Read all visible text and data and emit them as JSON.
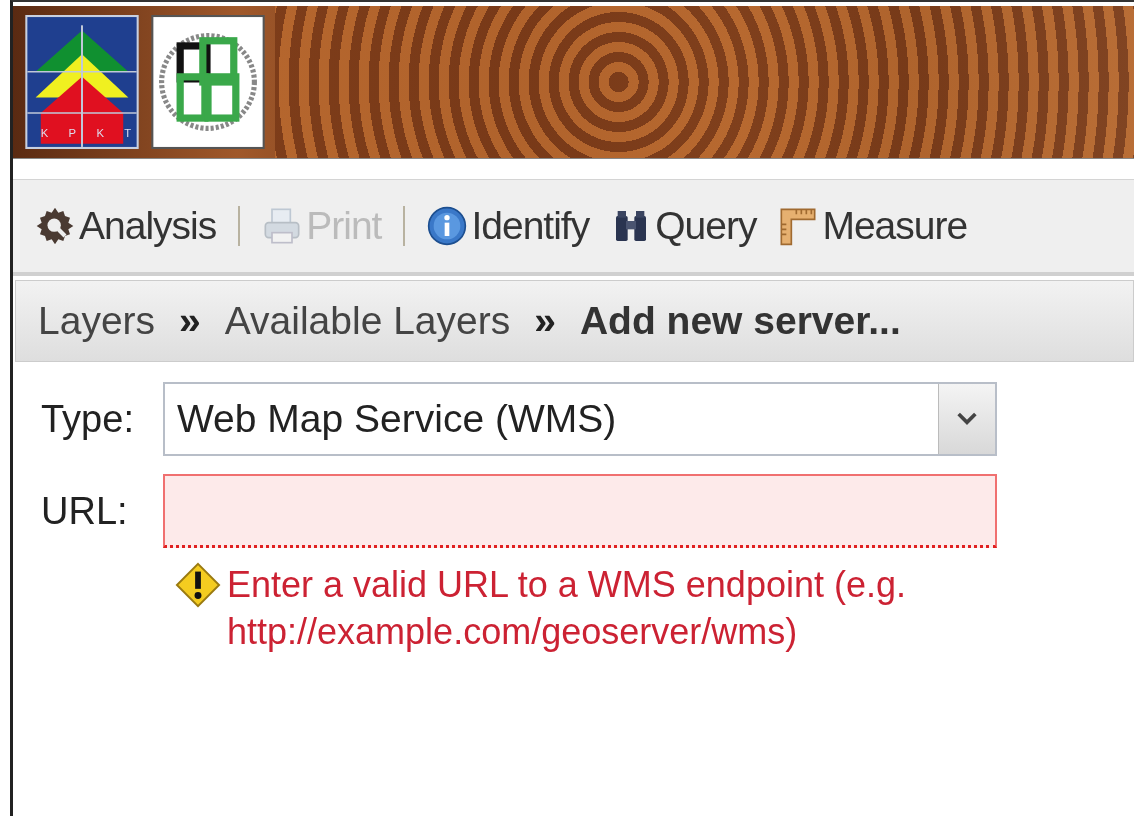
{
  "banner": {
    "logo_letters": [
      "K",
      "P",
      "K",
      "T"
    ]
  },
  "toolbar": [
    {
      "kind": "button",
      "label": "Analysis",
      "disabled": false
    },
    {
      "kind": "separator"
    },
    {
      "kind": "button",
      "label": "Print",
      "disabled": true
    },
    {
      "kind": "separator"
    },
    {
      "kind": "button",
      "label": "Identify",
      "disabled": false
    },
    {
      "kind": "button",
      "label": "Query",
      "disabled": false
    },
    {
      "kind": "button",
      "label": "Measure",
      "disabled": false
    }
  ],
  "breadcrumb": [
    {
      "label": "Layers",
      "current": false
    },
    {
      "label": "Available Layers",
      "current": false
    },
    {
      "label": "Add new server...",
      "current": true
    }
  ],
  "breadcrumb_separator": "»",
  "form": {
    "type": {
      "label": "Type:",
      "value": "Web Map Service (WMS)"
    },
    "url": {
      "label": "URL:",
      "invalid": true,
      "error": "Enter a valid URL to a WMS endpoint (e.g. http://example.com/geoserver/wms)"
    }
  }
}
